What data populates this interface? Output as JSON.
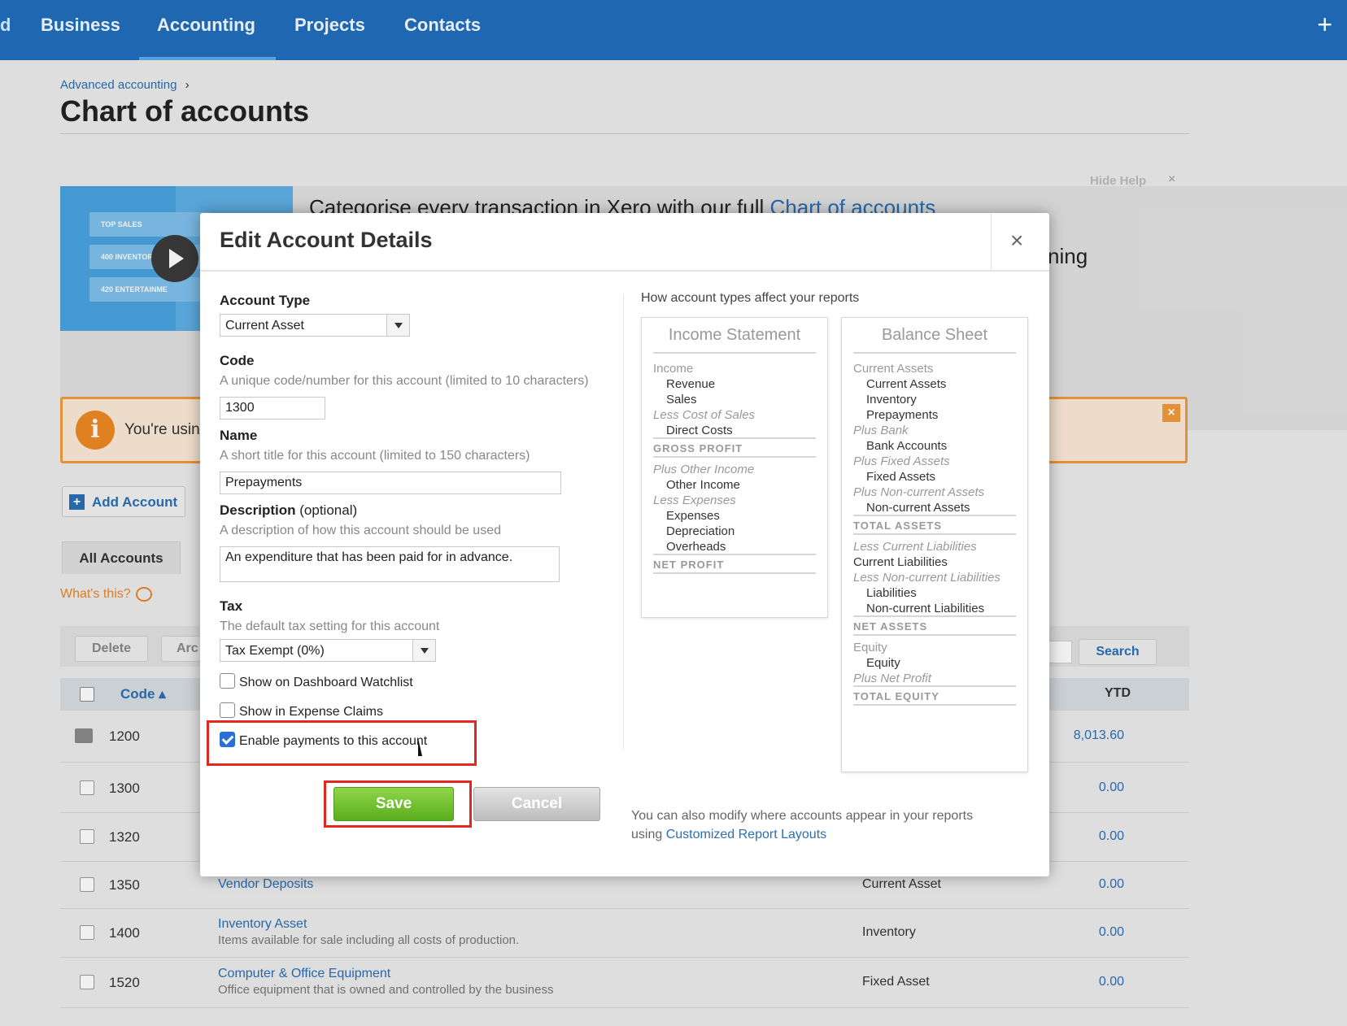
{
  "nav": {
    "edge": "d",
    "items": [
      "Business",
      "Accounting",
      "Projects",
      "Contacts"
    ],
    "plus": "+"
  },
  "page": {
    "breadcrumb": "Advanced accounting",
    "breadcrumb_sep": "›",
    "title": "Chart of accounts",
    "help_text": "Categorise every transaction in Xero with our full",
    "help_link": "Chart of accounts",
    "help_text2": "ning",
    "hide_help": "Hide Help",
    "video_tabs": [
      "TOP SALES",
      "400 INVENTORY",
      "420 ENTERTAINME"
    ],
    "notice_text": "You're usin",
    "add_account": "Add Account",
    "tab_all": "All Accounts",
    "whats_this": "What's this?",
    "delete": "Delete",
    "archive": "Arc",
    "search": "Search",
    "col_code": "Code ▴",
    "col_ytd": "YTD",
    "rows": [
      {
        "code": "1200",
        "name": "",
        "desc": "",
        "type": "",
        "ytd": "8,013.60",
        "locked": true
      },
      {
        "code": "1300",
        "name": "",
        "desc": "",
        "type": "",
        "ytd": "0.00"
      },
      {
        "code": "1320",
        "name": "",
        "desc": "",
        "type": "",
        "ytd": "0.00"
      },
      {
        "code": "1350",
        "name": "Vendor Deposits",
        "desc": "",
        "type": "Current Asset",
        "ytd": "0.00"
      },
      {
        "code": "1400",
        "name": "Inventory Asset",
        "desc": "Items available for sale including all costs of production.",
        "type": "Inventory",
        "ytd": "0.00"
      },
      {
        "code": "1520",
        "name": "Computer & Office Equipment",
        "desc": "Office equipment that is owned and controlled by the business",
        "type": "Fixed Asset",
        "ytd": "0.00"
      }
    ]
  },
  "modal": {
    "title": "Edit Account Details",
    "close": "×",
    "account_type_label": "Account Type",
    "account_type_value": "Current Asset",
    "code_label": "Code",
    "code_hint": "A unique code/number for this account (limited to 10 characters)",
    "code_value": "1300",
    "name_label": "Name",
    "name_hint": "A short title for this account (limited to 150 characters)",
    "name_value": "Prepayments",
    "desc_label": "Description",
    "desc_optional": "(optional)",
    "desc_hint": "A description of how this account should be used",
    "desc_value": "An expenditure that has been paid for in advance.",
    "tax_label": "Tax",
    "tax_hint": "The default tax setting for this account",
    "tax_value": "Tax Exempt (0%)",
    "cb_watchlist": "Show on Dashboard Watchlist",
    "cb_expense": "Show in Expense Claims",
    "cb_payments": "Enable payments to this account",
    "save": "Save",
    "cancel": "Cancel",
    "reports_title": "How account types affect your reports",
    "income_statement": {
      "title": "Income Statement",
      "lines": [
        [
          "g",
          "Income"
        ],
        [
          "d",
          "Revenue"
        ],
        [
          "d",
          "Sales"
        ],
        [
          "i",
          "Less Cost of Sales"
        ],
        [
          "d",
          "Direct Costs"
        ],
        [
          "b",
          "GROSS PROFIT"
        ],
        [
          "i",
          "Plus Other Income"
        ],
        [
          "d",
          "Other Income"
        ],
        [
          "i",
          "Less Expenses"
        ],
        [
          "d",
          "Expenses"
        ],
        [
          "d",
          "Depreciation"
        ],
        [
          "d",
          "Overheads"
        ],
        [
          "b",
          "NET PROFIT"
        ]
      ]
    },
    "balance_sheet": {
      "title": "Balance Sheet",
      "lines": [
        [
          "g",
          "Current Assets"
        ],
        [
          "d",
          "Current Assets"
        ],
        [
          "d",
          "Inventory"
        ],
        [
          "d",
          "Prepayments"
        ],
        [
          "i",
          "Plus Bank"
        ],
        [
          "d",
          "Bank Accounts"
        ],
        [
          "i",
          "Plus Fixed Assets"
        ],
        [
          "d",
          "Fixed Assets"
        ],
        [
          "i",
          "Plus Non-current Assets"
        ],
        [
          "d",
          "Non-current Assets"
        ],
        [
          "b",
          "TOTAL ASSETS"
        ],
        [
          "i",
          "Less Current Liabilities"
        ],
        [
          "d0",
          "Current Liabilities"
        ],
        [
          "i",
          "Less Non-current Liabilities"
        ],
        [
          "d",
          "Liabilities"
        ],
        [
          "d",
          "Non-current Liabilities"
        ],
        [
          "b",
          "NET ASSETS"
        ],
        [
          "g",
          "Equity"
        ],
        [
          "d",
          "Equity"
        ],
        [
          "i",
          "Plus Net Profit"
        ],
        [
          "b",
          "TOTAL EQUITY"
        ]
      ]
    },
    "footer_text": "You can also modify where accounts appear in your reports",
    "footer_using": "using",
    "footer_link": "Customized Report Layouts"
  }
}
